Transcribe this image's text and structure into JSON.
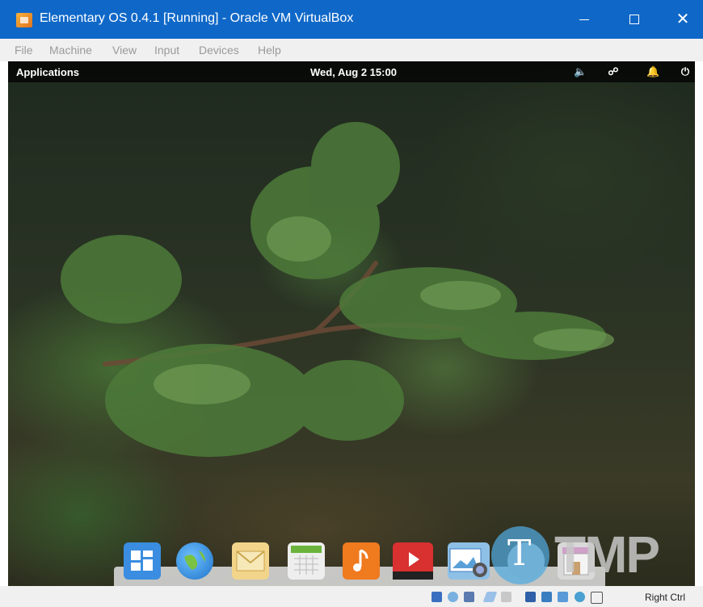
{
  "window": {
    "title": "Elementary OS 0.4.1 [Running] - Oracle VM VirtualBox",
    "controls": {
      "minimize": "—",
      "maximize": "☐",
      "close": "✕"
    }
  },
  "menu": [
    "File",
    "Machine",
    "View",
    "Input",
    "Devices",
    "Help"
  ],
  "guest_panel": {
    "applications": "Applications",
    "clock": "Wed, Aug  2   15:00",
    "tray_icons": [
      "volume-icon",
      "network-icon",
      "notification-bell-icon",
      "power-icon"
    ]
  },
  "dock": {
    "items": [
      "multitasking-view",
      "web-browser",
      "mail",
      "calendar",
      "music",
      "videos",
      "photos",
      "system-settings",
      "app-center"
    ]
  },
  "statusbar": {
    "icons": [
      "hard-disk-icon",
      "optical-drive-icon",
      "audio-icon",
      "network-adapter-icon",
      "usb-icon",
      "shared-folders-icon",
      "display-icon",
      "video-capture-icon",
      "mouse-integration-icon",
      "keyboard-capture-icon"
    ],
    "host_key": "Right Ctrl"
  },
  "watermark": {
    "text": "TMP",
    "letter": "T"
  },
  "colors": {
    "titlebar": "#0f68c8",
    "panel": "#000000",
    "menubar": "#f0f0f0"
  }
}
